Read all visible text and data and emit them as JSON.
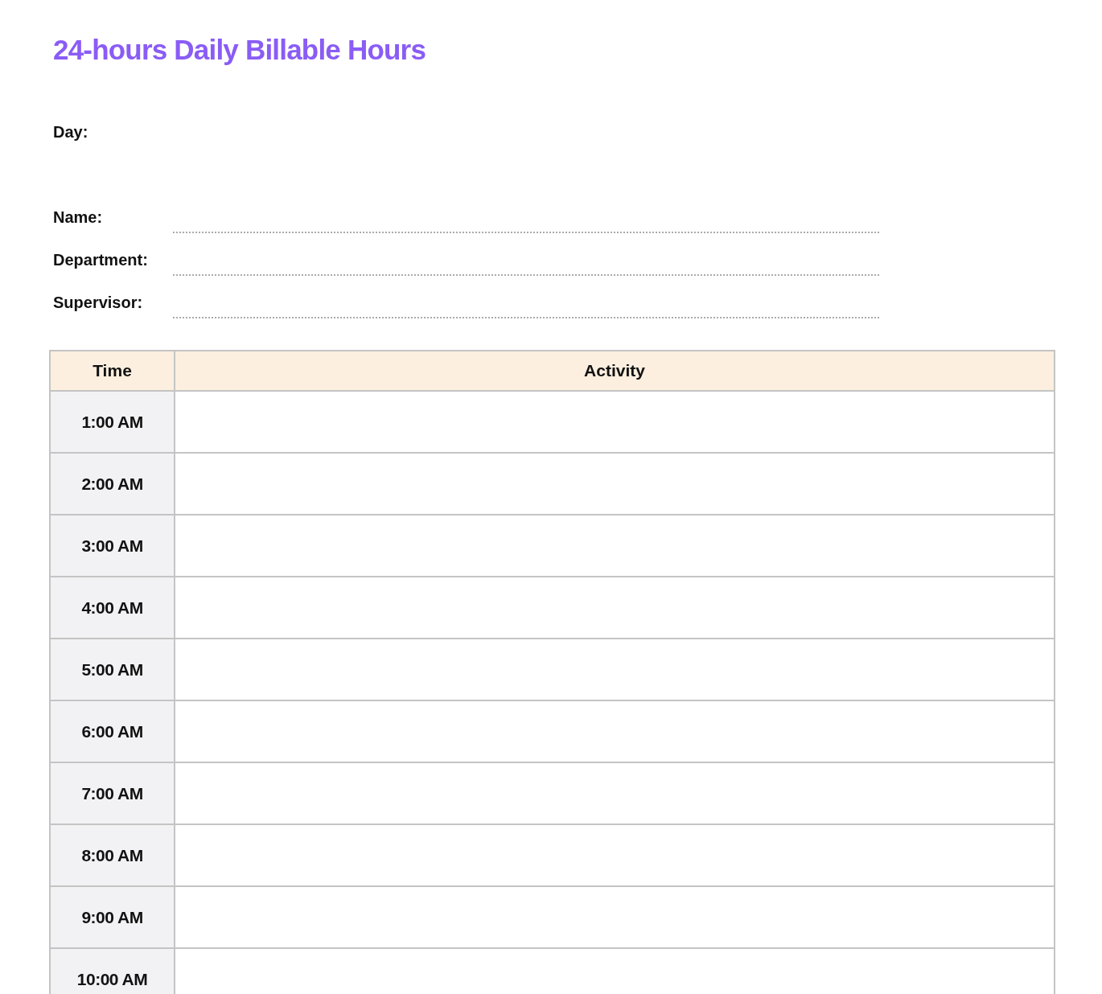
{
  "title": "24-hours Daily Billable Hours",
  "day_label": "Day:",
  "fields": [
    {
      "label": "Name:"
    },
    {
      "label": "Department:"
    },
    {
      "label": "Supervisor:"
    }
  ],
  "table": {
    "columns": [
      "Time",
      "Activity"
    ],
    "rows": [
      {
        "time": "1:00 AM"
      },
      {
        "time": "2:00 AM"
      },
      {
        "time": "3:00 AM"
      },
      {
        "time": "4:00 AM"
      },
      {
        "time": "5:00 AM"
      },
      {
        "time": "6:00 AM"
      },
      {
        "time": "7:00 AM"
      },
      {
        "time": "8:00 AM"
      },
      {
        "time": "9:00 AM"
      },
      {
        "time": "10:00 AM"
      }
    ]
  }
}
